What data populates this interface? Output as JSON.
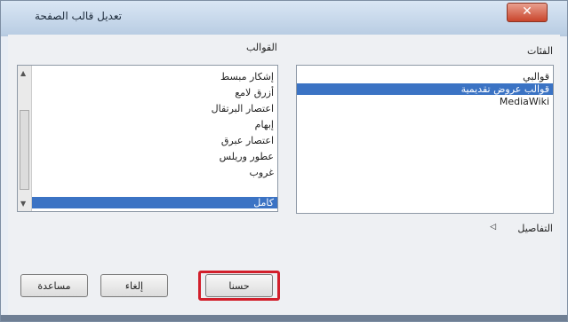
{
  "window": {
    "title": "تعديل قالب الصفحة",
    "close_glyph": "✕"
  },
  "categories": {
    "label": "الفئات",
    "items": [
      {
        "label": "قوالبي",
        "selected": false
      },
      {
        "label": "قوالب عروض تقديمية",
        "selected": true
      },
      {
        "label": "MediaWiki",
        "selected": false
      }
    ]
  },
  "templates": {
    "label": "القوالب",
    "items": [
      {
        "label": "إشكار مبسط",
        "selected": false
      },
      {
        "label": "أزرق لامع",
        "selected": false
      },
      {
        "label": "اعتصار البرتقال",
        "selected": false
      },
      {
        "label": "إبهام",
        "selected": false
      },
      {
        "label": "اعتصار عبرق",
        "selected": false
      },
      {
        "label": "عطور وريلس",
        "selected": false
      },
      {
        "label": "غروب",
        "selected": false
      },
      {
        "label": "كامل",
        "selected": true
      }
    ]
  },
  "details": {
    "label": "التفاصيل"
  },
  "buttons": {
    "ok": "حسنا",
    "cancel": "إلغاء",
    "help": "مساعدة"
  },
  "colors": {
    "selection": "#3b73c4",
    "highlight_border": "#d21f2b"
  }
}
